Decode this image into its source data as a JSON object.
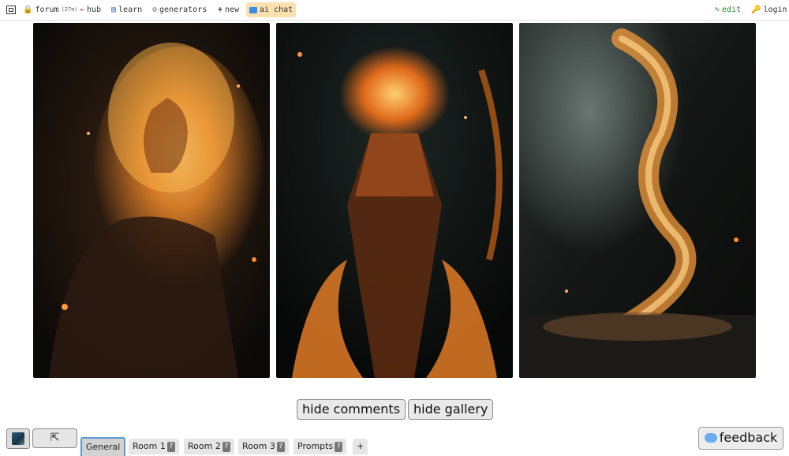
{
  "nav": {
    "items": [
      {
        "label": "forum",
        "meta": "(27m)",
        "icon": "lock-icon"
      },
      {
        "label": "hub",
        "icon": "feather-icon"
      },
      {
        "label": "learn",
        "icon": "book-icon"
      },
      {
        "label": "generators",
        "icon": "gear-icon"
      },
      {
        "label": "new",
        "icon": "plus-icon"
      },
      {
        "label": "ai chat",
        "icon": "chat-icon"
      }
    ],
    "edit": "edit",
    "login": "login"
  },
  "gallery": {
    "images": [
      {
        "alt": "glowing ember woman"
      },
      {
        "alt": "fiery ember humanoid"
      },
      {
        "alt": "swirling ember vortex"
      }
    ]
  },
  "controls": {
    "hide_comments": "hide comments",
    "hide_gallery": "hide gallery",
    "collapse_glyph": "⇱"
  },
  "chat": {
    "tabs": [
      {
        "label": "General",
        "badge": ""
      },
      {
        "label": "Room 1",
        "badge": "?"
      },
      {
        "label": "Room 2",
        "badge": "?"
      },
      {
        "label": "Room 3",
        "badge": "?"
      },
      {
        "label": "Prompts",
        "badge": "?"
      },
      {
        "label": "+",
        "badge": ""
      }
    ],
    "active_tab": "General"
  },
  "feedback": "feedback",
  "colors": {
    "accent_nav": "#fde0b0",
    "active_tab_border": "#5b9bd5",
    "edit_green": "#2d8a2d"
  }
}
